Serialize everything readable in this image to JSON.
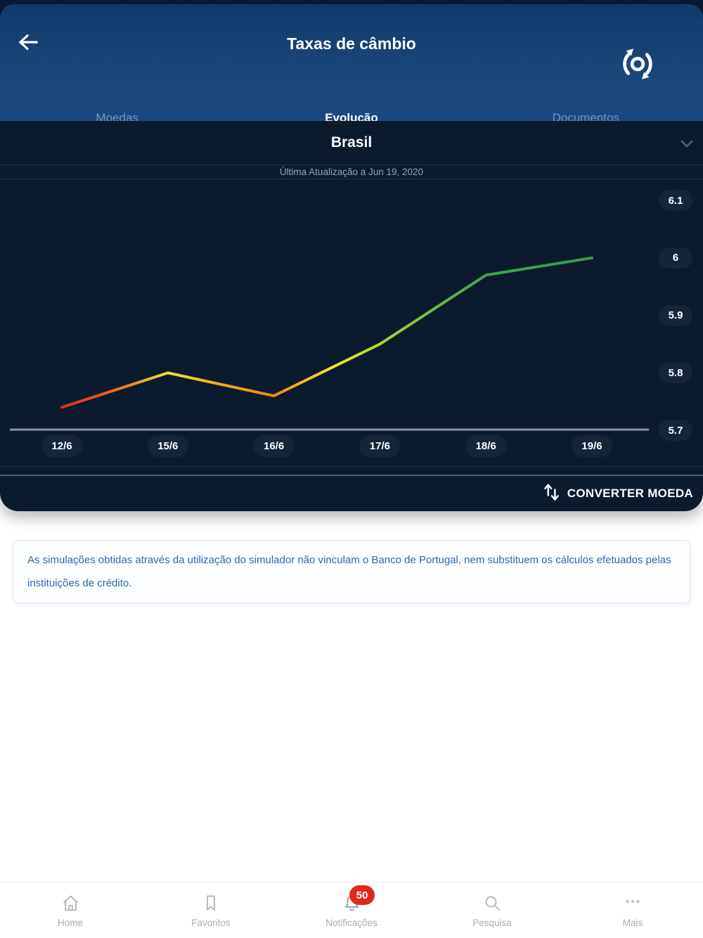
{
  "header": {
    "title": "Taxas de câmbio"
  },
  "tabs": [
    {
      "label": "Moedas",
      "active": false
    },
    {
      "label": "Evolução",
      "active": true
    },
    {
      "label": "Documentos",
      "active": false
    }
  ],
  "sheet": {
    "country": "Brasil",
    "last_update": "Última Atualização a Jun 19, 2020",
    "converter_label": "CONVERTER MOEDA"
  },
  "chart_data": {
    "type": "line",
    "title": "",
    "xlabel": "",
    "ylabel": "",
    "categories": [
      "12/6",
      "15/6",
      "16/6",
      "17/6",
      "18/6",
      "19/6"
    ],
    "values": [
      5.74,
      5.8,
      5.76,
      5.85,
      5.97,
      6.0
    ],
    "y_ticks": [
      "6.1",
      "6",
      "5.9",
      "5.8",
      "5.7"
    ],
    "ylim": [
      5.7,
      6.1
    ],
    "grid": false,
    "legend": false,
    "axis_color": "#8b93a2",
    "tick_badge_bg": "#152539",
    "line_gradient": [
      {
        "offset": 0.0,
        "color": "#dc2a26"
      },
      {
        "offset": 0.1,
        "color": "#ea6b1e"
      },
      {
        "offset": 0.2,
        "color": "#e9e23a"
      },
      {
        "offset": 0.3,
        "color": "#edaa24"
      },
      {
        "offset": 0.4,
        "color": "#ee8517"
      },
      {
        "offset": 0.51,
        "color": "#f6e13a"
      },
      {
        "offset": 0.6,
        "color": "#b4d334"
      },
      {
        "offset": 0.7,
        "color": "#6abc43"
      },
      {
        "offset": 0.8,
        "color": "#3ba750"
      },
      {
        "offset": 1.0,
        "color": "#2f9e4e"
      }
    ]
  },
  "disclaimer": "As simulações obtidas através da utilização do simulador não vinculam o Banco de Portugal, nem substituem os cálculos efetuados pelas instituições de crédito.",
  "nav": {
    "items": [
      {
        "label": "Home"
      },
      {
        "label": "Favoritos"
      },
      {
        "label": "Notificações",
        "badge": "50"
      },
      {
        "label": "Pesquisa"
      },
      {
        "label": "Mais"
      }
    ]
  },
  "colors": {
    "header_blue": "#174679",
    "sheet_bg": "#0b1a2d",
    "divider": "#243349",
    "badge_red": "#df2b1f",
    "disclaimer_text": "#2b66ae",
    "nav_gray": "#a6abb1"
  }
}
